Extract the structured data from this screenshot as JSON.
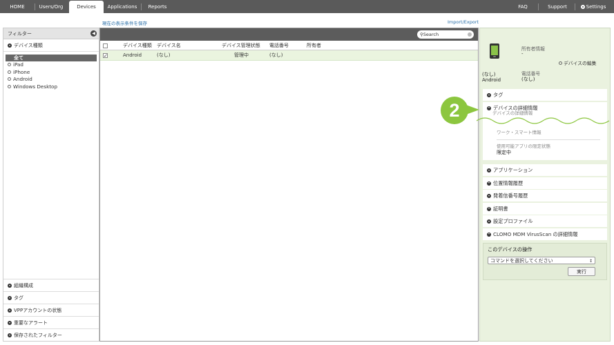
{
  "nav": {
    "home": "HOME",
    "users_org": "Users/Org",
    "devices": "Devices",
    "applications": "Applications",
    "reports": "Reports",
    "faq": "FAQ",
    "support": "Support",
    "settings": "Settings"
  },
  "links": {
    "save_filter": "現在の表示条件を保存",
    "import_export": "Import/Export"
  },
  "filter": {
    "title": "フィルター",
    "device_type": "デバイス種類",
    "tree": [
      "全て",
      "iPad",
      "iPhone",
      "Android",
      "Windows Desktop"
    ],
    "bottom": [
      "組織構成",
      "タグ",
      "VPPアカウントの状態",
      "重要なアラート",
      "保存されたフィルター"
    ]
  },
  "table": {
    "search_placeholder": "Search",
    "columns": [
      "デバイス種類",
      "デバイス名",
      "デバイス管理状態",
      "電話番号",
      "所有者"
    ],
    "rows": [
      {
        "type": "Android",
        "name": "(なし)",
        "status": "管理中",
        "phone": "(なし)",
        "owner": "",
        "checked": true
      }
    ]
  },
  "detail": {
    "device_name": "(なし)",
    "device_type": "Android",
    "owner_label": "所有者情報",
    "owner_value": "-",
    "phone_label": "電話番号",
    "phone_value": "(なし)",
    "edit_link": "デバイスの編集",
    "accordions": {
      "tag": "タグ",
      "details": "デバイスの詳細情報",
      "details_sub": "デバイスの詳細情報",
      "work_smart": "ワーク・スマート情報",
      "app_limit_label": "使用可能アプリの限定状態",
      "app_limit_value": "限定中",
      "applications": "アプリケーション",
      "location": "位置情報履歴",
      "calls": "発着信番号履歴",
      "certificates": "証明書",
      "profiles": "設定プロファイル",
      "virusscan": "CLOMO MDM VirusScan の詳細情報"
    },
    "ops_title": "このデバイスの操作",
    "command_select": "コマンドを選択してください",
    "execute": "実行"
  },
  "annotation": {
    "step": "2",
    "color": "#8cc63f"
  }
}
